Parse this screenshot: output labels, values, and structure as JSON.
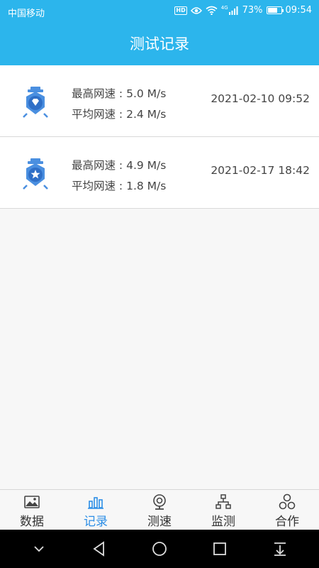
{
  "status_bar": {
    "carrier": "中国移动",
    "hd": "HD",
    "network": "4G",
    "battery": "73%",
    "battery_level": 0.73,
    "time": "09:54"
  },
  "header": {
    "title": "测试记录"
  },
  "records": [
    {
      "max_label": "最高网速 : 5.0 M/s",
      "avg_label": "平均网速 : 2.4 M/s",
      "datetime": "2021-02-10 09:52",
      "badge_icon": "diamond-badge-icon"
    },
    {
      "max_label": "最高网速 : 4.9 M/s",
      "avg_label": "平均网速 : 1.8 M/s",
      "datetime": "2021-02-17 18:42",
      "badge_icon": "star-badge-icon"
    }
  ],
  "tabs": [
    {
      "label": "数据",
      "icon": "image-icon",
      "active": false
    },
    {
      "label": "记录",
      "icon": "bar-chart-icon",
      "active": true
    },
    {
      "label": "测速",
      "icon": "webcam-icon",
      "active": false
    },
    {
      "label": "监测",
      "icon": "network-icon",
      "active": false
    },
    {
      "label": "合作",
      "icon": "cooperation-icon",
      "active": false
    }
  ],
  "colors": {
    "primary": "#2cb5ec",
    "active_tab": "#2c8ee6",
    "badge": "#4a8fe0"
  }
}
